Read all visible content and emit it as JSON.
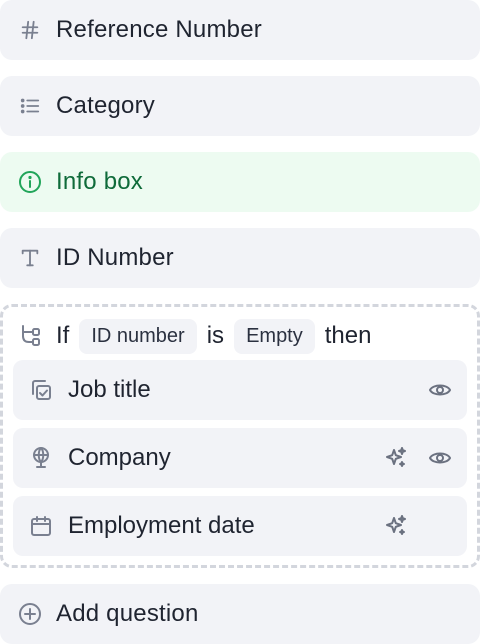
{
  "fields": {
    "reference": {
      "label": "Reference Number",
      "icon": "hash-icon"
    },
    "category": {
      "label": "Category",
      "icon": "list-icon"
    },
    "info": {
      "label": "Info box",
      "icon": "info-icon",
      "color": "#22a55a"
    },
    "id_number": {
      "label": "ID Number",
      "icon": "text-icon"
    }
  },
  "condition": {
    "if": "If",
    "field": "ID number",
    "is": "is",
    "value": "Empty",
    "then": "then",
    "icon": "branch-icon",
    "items": [
      {
        "label": "Job title",
        "icon": "copy-check-icon",
        "actions": [
          "eye-icon"
        ]
      },
      {
        "label": "Company",
        "icon": "globe-pin-icon",
        "actions": [
          "sparkle-icon",
          "eye-icon"
        ]
      },
      {
        "label": "Employment date",
        "icon": "calendar-icon",
        "actions": [
          "sparkle-icon"
        ]
      }
    ]
  },
  "add_question": {
    "label": "Add question",
    "icon": "plus-circle-icon"
  }
}
